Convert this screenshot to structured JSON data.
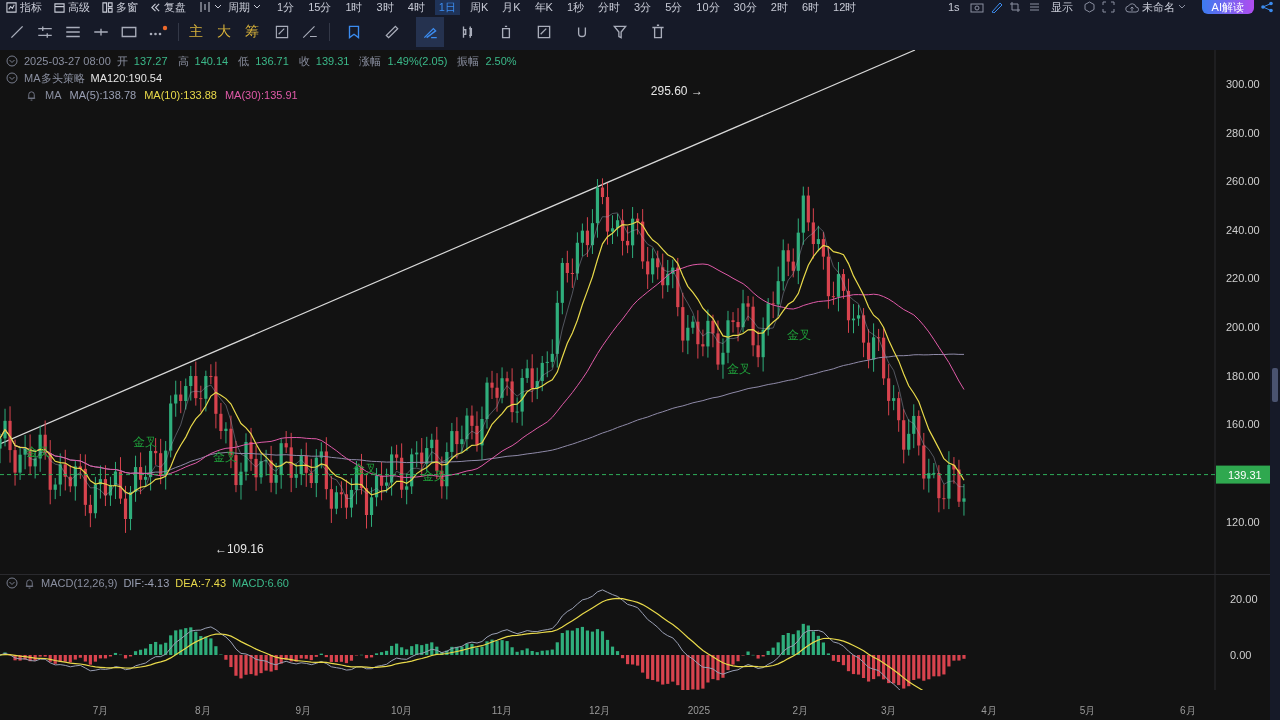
{
  "menu": [
    {
      "label": "指标"
    },
    {
      "label": "高级"
    },
    {
      "label": "多窗"
    },
    {
      "label": "复盘"
    }
  ],
  "period_menu": {
    "label": "周期"
  },
  "periods": [
    {
      "label": "1分",
      "selected": false
    },
    {
      "label": "15分",
      "selected": false
    },
    {
      "label": "1时",
      "selected": false
    },
    {
      "label": "3时",
      "selected": false
    },
    {
      "label": "4时",
      "selected": false
    },
    {
      "label": "1日",
      "selected": true
    },
    {
      "label": "周K",
      "selected": false
    },
    {
      "label": "月K",
      "selected": false
    },
    {
      "label": "年K",
      "selected": false
    },
    {
      "label": "1秒",
      "selected": false
    },
    {
      "label": "分时",
      "selected": false
    },
    {
      "label": "3分",
      "selected": false
    },
    {
      "label": "5分",
      "selected": false
    },
    {
      "label": "10分",
      "selected": false
    },
    {
      "label": "30分",
      "selected": false
    },
    {
      "label": "2时",
      "selected": false
    },
    {
      "label": "6时",
      "selected": false
    },
    {
      "label": "12时",
      "selected": false
    }
  ],
  "toolbar_right": {
    "refresh": "1s",
    "display": "显示",
    "layout_name": "未命名",
    "ai_button": "AI解读"
  },
  "indicator_tools": [
    "主",
    "大",
    "筹"
  ],
  "draw_tools": [
    {
      "selected": false
    },
    {
      "selected": false
    },
    {
      "selected": true
    },
    {
      "selected": false
    },
    {
      "selected": false
    },
    {
      "selected": false
    },
    {
      "selected": false
    },
    {
      "selected": false
    },
    {
      "selected": false
    }
  ],
  "legend": {
    "date": "2025-03-27 08:00",
    "fields": [
      {
        "label": "开",
        "value": "137.27"
      },
      {
        "label": "高",
        "value": "140.14"
      },
      {
        "label": "低",
        "value": "136.71"
      },
      {
        "label": "收",
        "value": "139.31"
      },
      {
        "label": "涨幅",
        "value": "1.49%(2.05)"
      },
      {
        "label": "振幅",
        "value": "2.50%"
      }
    ]
  },
  "strategy": {
    "name": "MA多头策略",
    "value": "MA120:190.54"
  },
  "ma_legend": {
    "name": "MA",
    "items": [
      {
        "text": "MA(5):138.78",
        "color": "#9aa0b4"
      },
      {
        "text": "MA(10):133.88",
        "color": "#e8d94a"
      },
      {
        "text": "MA(30):135.91",
        "color": "#e05aa8"
      }
    ]
  },
  "price_axis": [
    "300.00",
    "280.00",
    "260.00",
    "240.00",
    "220.00",
    "200.00",
    "180.00",
    "160.00",
    "120.00"
  ],
  "last_price": "139.31",
  "chart_labels": [
    {
      "text": "295.60 →",
      "kind": "high"
    },
    {
      "text": "←109.16",
      "kind": "low"
    },
    {
      "text": "金叉",
      "kind": "signal"
    },
    {
      "text": "金叉",
      "kind": "signal"
    },
    {
      "text": "金叉",
      "kind": "signal"
    },
    {
      "text": "金叉",
      "kind": "signal"
    },
    {
      "text": "金叉",
      "kind": "signal"
    },
    {
      "text": "金叉",
      "kind": "signal"
    },
    {
      "text": "金叉",
      "kind": "signal"
    }
  ],
  "macd_legend": {
    "name": "MACD(12,26,9)",
    "items": [
      {
        "text": "DIF:-4.13",
        "color": "#9aa0b4"
      },
      {
        "text": "DEA:-7.43",
        "color": "#e8d94a"
      },
      {
        "text": "MACD:6.60",
        "color": "#3bb98a"
      }
    ]
  },
  "macd_axis": [
    "20.00",
    "0.00"
  ],
  "date_axis": [
    "7月",
    "8月",
    "9月",
    "10月",
    "11月",
    "12月",
    "2025",
    "2月",
    "3月",
    "4月",
    "5月",
    "6月"
  ]
}
